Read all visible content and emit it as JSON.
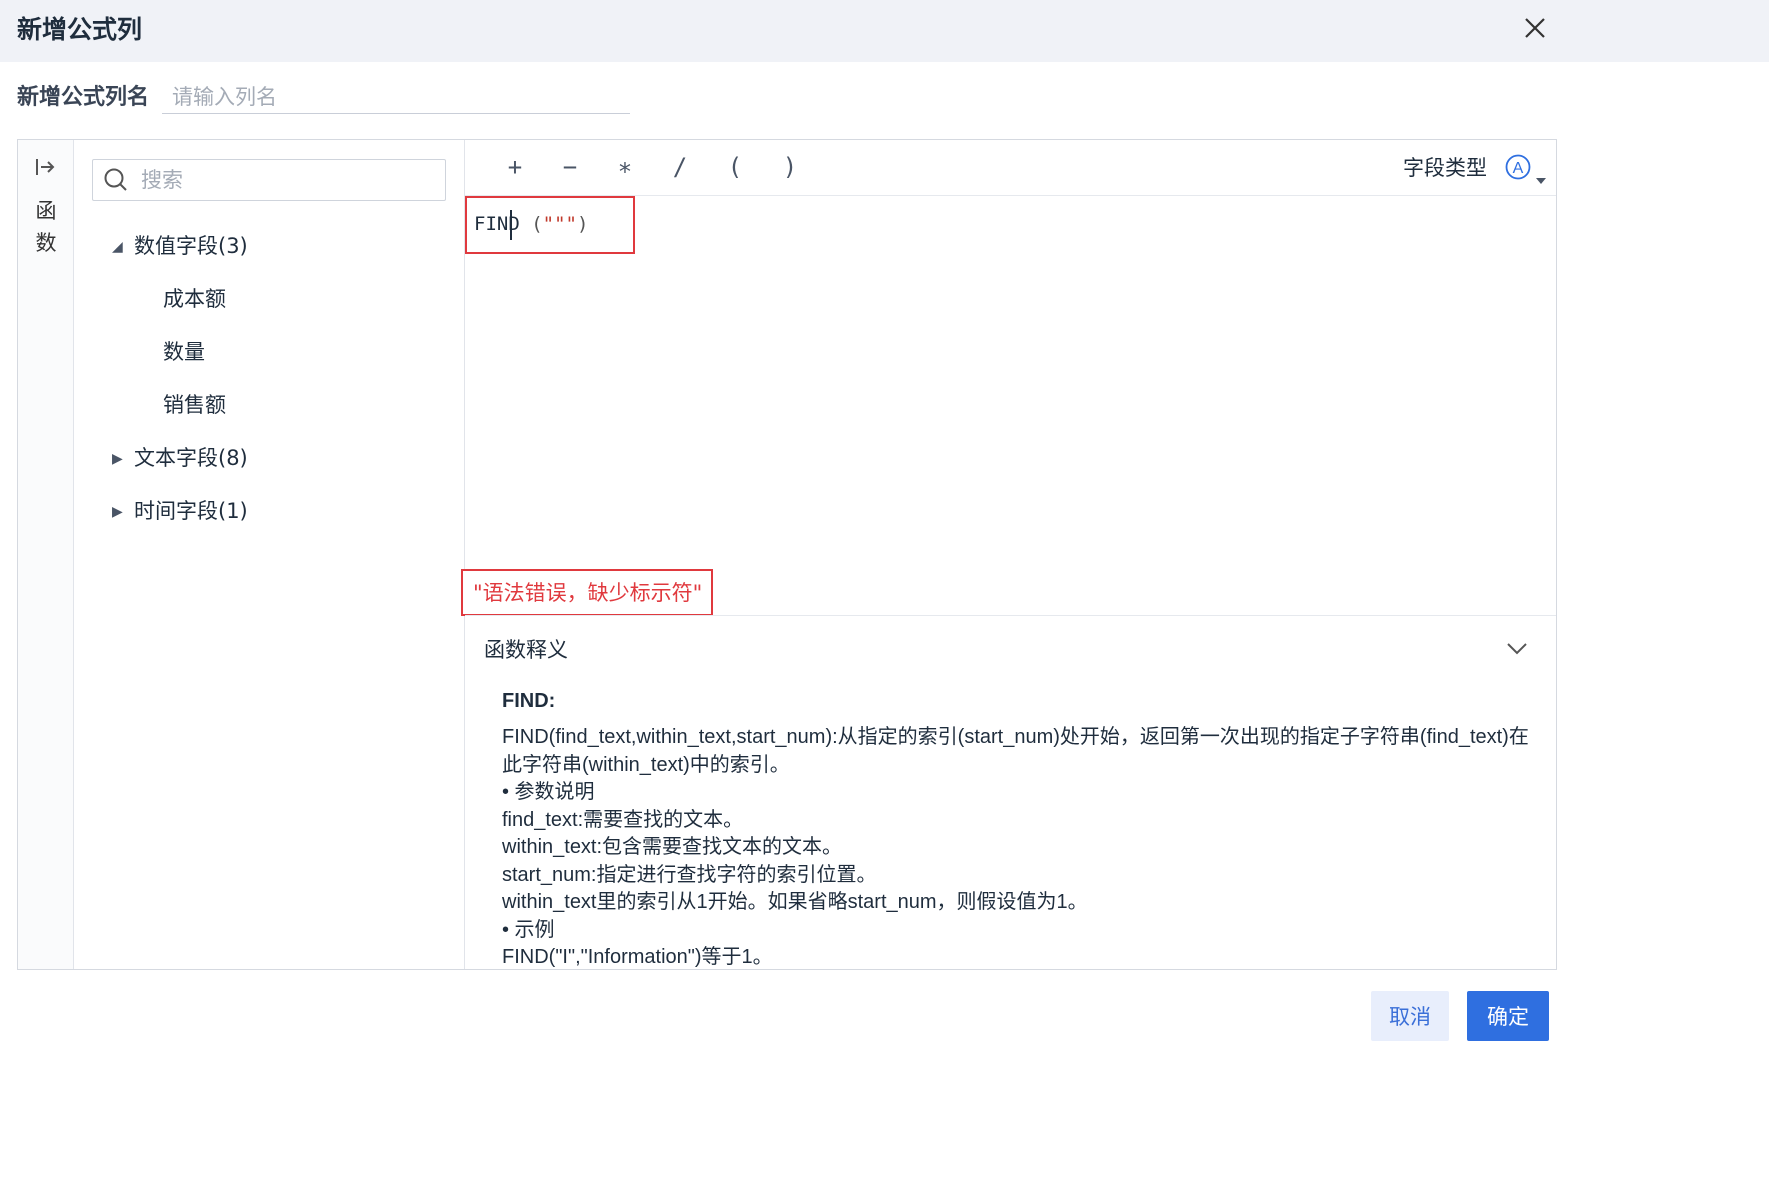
{
  "dialog": {
    "title": "新增公式列"
  },
  "name_field": {
    "label": "新增公式列名",
    "placeholder": "请输入列名"
  },
  "rail": {
    "label": "函数",
    "icon": "collapse-arrow-icon"
  },
  "search": {
    "placeholder": "搜索"
  },
  "field_tree": {
    "groups": [
      {
        "label": "数值字段(3)",
        "expanded": true,
        "children": [
          "成本额",
          "数量",
          "销售额"
        ]
      },
      {
        "label": "文本字段(8)",
        "expanded": false
      },
      {
        "label": "时间字段(1)",
        "expanded": false
      }
    ]
  },
  "toolbar": {
    "operators": [
      "+",
      "−",
      "∗",
      "/",
      "(",
      ")"
    ],
    "field_type_label": "字段类型",
    "field_type_icon": "A"
  },
  "formula": {
    "func": "FIND",
    "open": "(",
    "arg": "\"\"\"",
    "close": ")"
  },
  "error": {
    "message": "\"语法错误，缺少标示符\"",
    "color": "#e0393e"
  },
  "doc": {
    "title": "函数释义",
    "func_name": "FIND:",
    "lines": [
      "FIND(find_text,within_text,start_num):从指定的索引(start_num)处开始，返回第一次出现的指定子字符串(find_text)在此字符串(within_text)中的索引。",
      "• 参数说明",
      "find_text:需要查找的文本。",
      "within_text:包含需要查找文本的文本。",
      "start_num:指定进行查找字符的索引位置。",
      "within_text里的索引从1开始。如果省略start_num，则假设值为1。",
      "• 示例",
      "FIND(\"I\",\"Information\")等于1。"
    ]
  },
  "footer": {
    "cancel_label": "取消",
    "confirm_label": "确定"
  },
  "colors": {
    "accent": "#2f6fe0",
    "header_bg": "#f0f2f7",
    "error": "#e0393e"
  }
}
